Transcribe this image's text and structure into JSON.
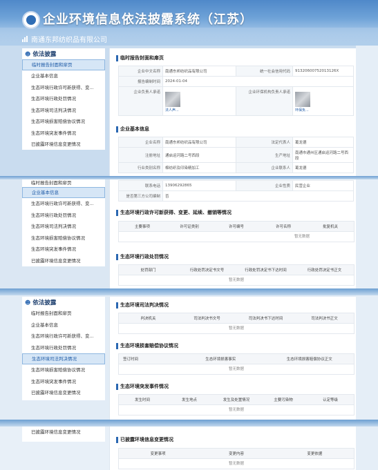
{
  "header": {
    "title": "企业环境信息依法披露系统（江苏）",
    "company": "南通东邦纺织品有限公司"
  },
  "sidebar": {
    "title": "依法披露",
    "items": [
      "临时报告封面和扉页",
      "企业基本信息",
      "生态环境行政许可新获得、变...",
      "生态环境行政处罚情况",
      "生态环境司法判决情况",
      "生态环境损害赔偿协议情况",
      "生态环境突发事件情况",
      "已披露环境信息变更情况"
    ]
  },
  "cover": {
    "title": "临时报告封面和扉页",
    "name_label": "企业中文名称",
    "name_value": "南通东邦纺织品有限公司",
    "code_label": "统一社会信用代码",
    "code_value": "91320600752013126X",
    "date_label": "报告编制时间",
    "date_value": "2024-01-04",
    "rep_label": "企业负责人承诺",
    "rep_link": "法人声...",
    "org_label": "企业环保机构负责人承诺",
    "org_link": "环保负..."
  },
  "basic": {
    "title": "企业基本信息",
    "name_label": "企业名称",
    "name_value": "南通东邦纺织品有限公司",
    "legal_label": "法定代表人",
    "legal_value": "葛龙德",
    "reg_label": "注册地址",
    "reg_value": "通启运河路二号西段",
    "prod_label": "生产地址",
    "prod_value": "南通市通州区通启运河路二号西段",
    "ind_label": "行业类别名称",
    "ind_value": "棉纺织及印染精加工",
    "contact_label": "企业联系人",
    "contact_value": "葛龙德",
    "phone_label": "联系电话",
    "phone_value": "13906292865",
    "nature_label": "企业性质",
    "nature_value": "民营企业",
    "third_label": "是否第三方公司编制",
    "third_value": "否"
  },
  "permit": {
    "title": "生态环境行政许可新获得、变更、延续、撤销等情况",
    "cols": [
      "主要事项",
      "许可证类别",
      "许可编号",
      "许可名称",
      "批复机关"
    ],
    "empty": "暂无数据"
  },
  "penalty": {
    "title": "生态环境行政处罚情况",
    "cols": [
      "处罚部门",
      "行政处罚决定书文号",
      "行政处罚决定书下达时间",
      "行政处罚决定书正文"
    ],
    "empty": "暂无数据"
  },
  "judicial": {
    "title": "生态环境司法判决情况",
    "cols": [
      "判决机关",
      "司法判决书文号",
      "司法判决书下达时间",
      "司法判决书正文"
    ],
    "empty": "暂无数据"
  },
  "damage": {
    "title": "生态环境损害赔偿协议情况",
    "cols": [
      "签订时间",
      "生态环境损害事实",
      "生态环境损害赔偿协议正文"
    ],
    "empty": "暂无数据"
  },
  "incident": {
    "title": "生态环境突发事件情况",
    "cols": [
      "发生时间",
      "发生地点",
      "发生及处置情况",
      "主要污染物",
      "认定等级"
    ],
    "empty": "暂无数据"
  },
  "change": {
    "title": "已披露环境信息变更情况",
    "cols": [
      "变更事项",
      "变更内容",
      "变更依据"
    ],
    "empty": "暂无数据"
  }
}
